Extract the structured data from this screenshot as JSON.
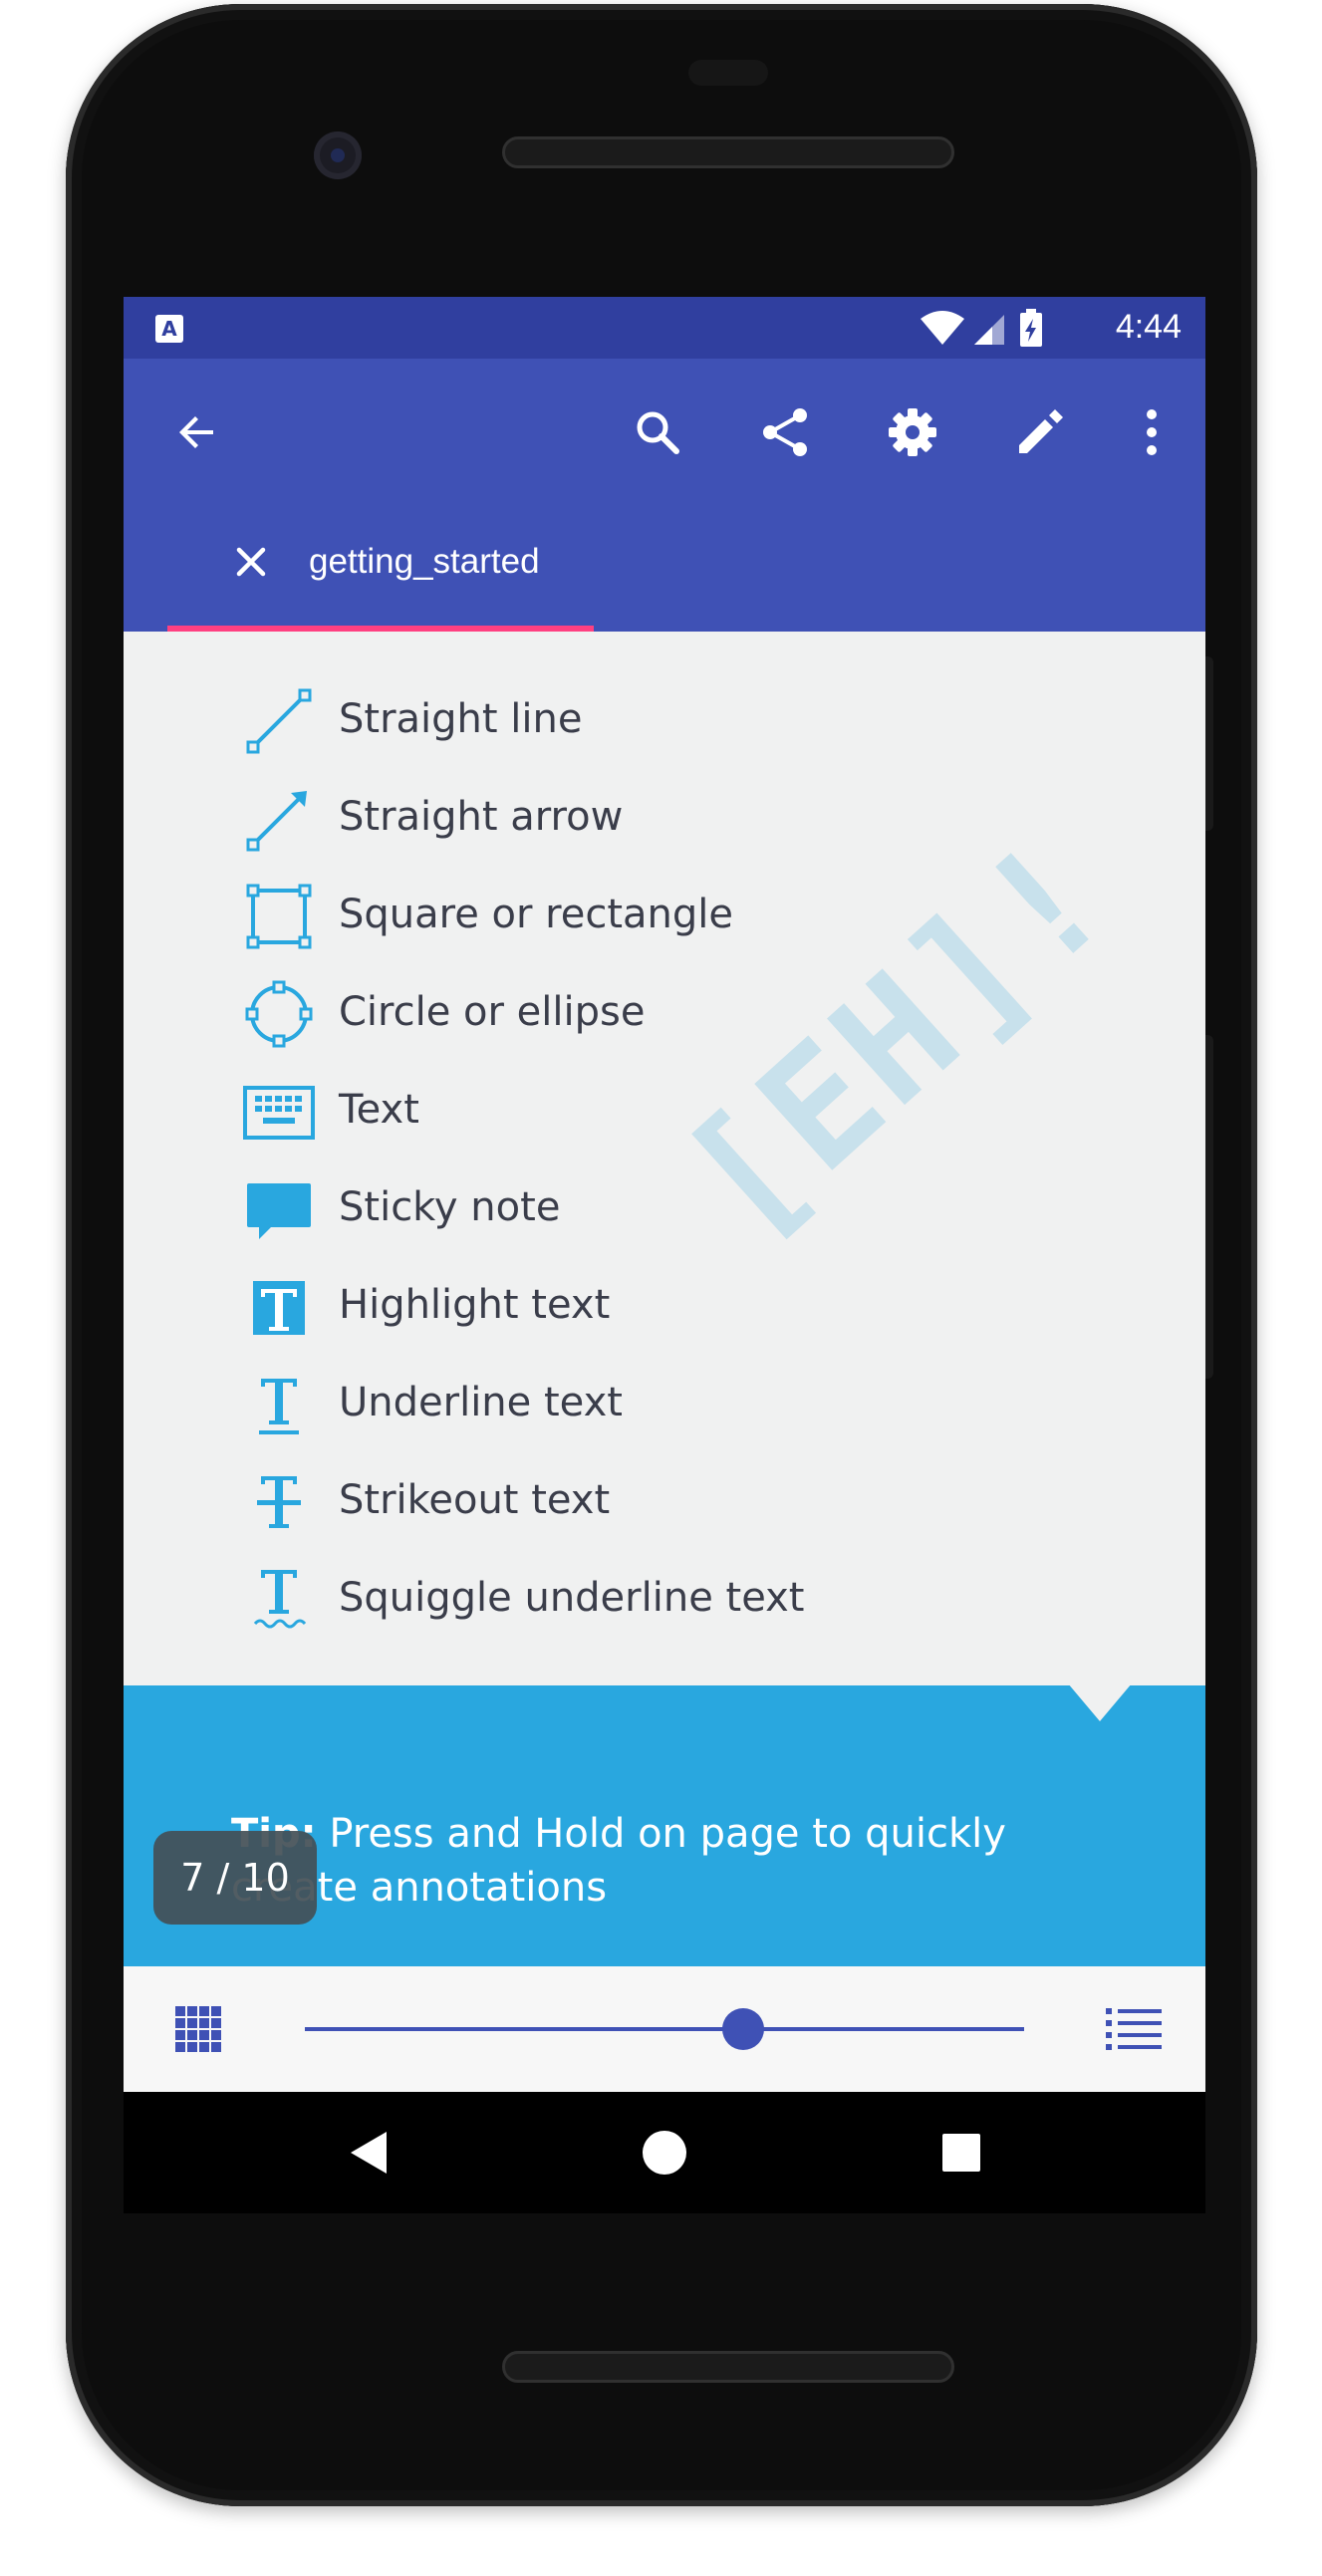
{
  "status_bar": {
    "notification_icon": "A",
    "time": "4:44",
    "icons": [
      "wifi-icon",
      "cell-signal-icon",
      "battery-charging-icon"
    ]
  },
  "toolbar": {
    "icons": [
      "back-arrow-icon",
      "search-icon",
      "share-icon",
      "settings-gear-icon",
      "edit-pencil-icon",
      "more-vert-icon"
    ]
  },
  "tab": {
    "label": "getting_started",
    "close_icon": "close-icon"
  },
  "tools": [
    {
      "label": "Straight line",
      "icon": "straight-line-icon"
    },
    {
      "label": "Straight arrow",
      "icon": "straight-arrow-icon"
    },
    {
      "label": "Square or rectangle",
      "icon": "square-icon"
    },
    {
      "label": "Circle or ellipse",
      "icon": "circle-icon"
    },
    {
      "label": "Text",
      "icon": "keyboard-icon"
    },
    {
      "label": "Sticky note",
      "icon": "sticky-note-icon"
    },
    {
      "label": "Highlight text",
      "icon": "highlight-text-icon"
    },
    {
      "label": "Underline text",
      "icon": "underline-text-icon"
    },
    {
      "label": "Strikeout text",
      "icon": "strikeout-text-icon"
    },
    {
      "label": "Squiggle underline text",
      "icon": "squiggle-underline-icon"
    }
  ],
  "watermark": "[EH]!",
  "tip": {
    "bold": "Tip:",
    "text": " Press and Hold on page to quickly create annotations"
  },
  "page_indicator": "7 / 10",
  "bottom_bar": {
    "slider_fraction": 0.61,
    "left_icon": "thumbnails-grid-icon",
    "right_icon": "outline-list-icon"
  },
  "colors": {
    "primary": "#3f51b5",
    "primary_dark": "#303f9f",
    "accent": "#ff4081",
    "tool_blue": "#29a7df",
    "background": "#f0f1f1"
  }
}
